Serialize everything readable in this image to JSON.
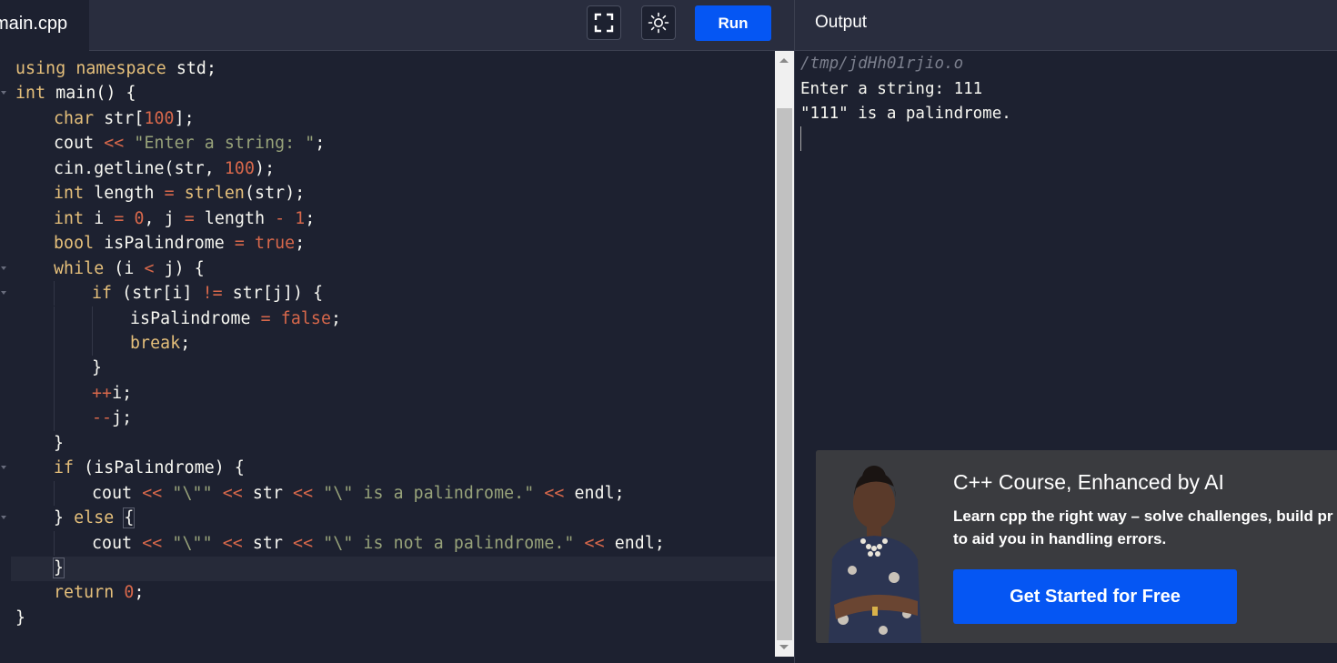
{
  "editor": {
    "file_tab": "main.cpp",
    "run_label": "Run",
    "lines": [
      {
        "indent": 0,
        "fold": false,
        "tokens": [
          {
            "t": "using",
            "c": "kw"
          },
          {
            "t": " "
          },
          {
            "t": "namespace",
            "c": "kw"
          },
          {
            "t": " std;"
          }
        ]
      },
      {
        "indent": 0,
        "fold": true,
        "tokens": [
          {
            "t": "int",
            "c": "kw"
          },
          {
            "t": " main() {"
          }
        ]
      },
      {
        "indent": 1,
        "fold": false,
        "tokens": [
          {
            "t": "char",
            "c": "kw"
          },
          {
            "t": " str["
          },
          {
            "t": "100",
            "c": "num"
          },
          {
            "t": "];"
          }
        ]
      },
      {
        "indent": 1,
        "fold": false,
        "tokens": [
          {
            "t": "cout "
          },
          {
            "t": "<<",
            "c": "op"
          },
          {
            "t": " "
          },
          {
            "t": "\"Enter a string: \"",
            "c": "str"
          },
          {
            "t": ";"
          }
        ]
      },
      {
        "indent": 1,
        "fold": false,
        "tokens": [
          {
            "t": "cin.getline(str, "
          },
          {
            "t": "100",
            "c": "num"
          },
          {
            "t": ");"
          }
        ]
      },
      {
        "indent": 1,
        "fold": false,
        "tokens": [
          {
            "t": "int",
            "c": "kw"
          },
          {
            "t": " length "
          },
          {
            "t": "=",
            "c": "op"
          },
          {
            "t": " "
          },
          {
            "t": "strlen",
            "c": "kw"
          },
          {
            "t": "(str);"
          }
        ]
      },
      {
        "indent": 1,
        "fold": false,
        "tokens": [
          {
            "t": "int",
            "c": "kw"
          },
          {
            "t": " i "
          },
          {
            "t": "=",
            "c": "op"
          },
          {
            "t": " "
          },
          {
            "t": "0",
            "c": "num"
          },
          {
            "t": ", j "
          },
          {
            "t": "=",
            "c": "op"
          },
          {
            "t": " length "
          },
          {
            "t": "-",
            "c": "op"
          },
          {
            "t": " "
          },
          {
            "t": "1",
            "c": "num"
          },
          {
            "t": ";"
          }
        ]
      },
      {
        "indent": 1,
        "fold": false,
        "tokens": [
          {
            "t": "bool",
            "c": "kw"
          },
          {
            "t": " isPalindrome "
          },
          {
            "t": "=",
            "c": "op"
          },
          {
            "t": " "
          },
          {
            "t": "true",
            "c": "num"
          },
          {
            "t": ";"
          }
        ]
      },
      {
        "indent": 1,
        "fold": true,
        "tokens": [
          {
            "t": "while",
            "c": "kw"
          },
          {
            "t": " (i "
          },
          {
            "t": "<",
            "c": "op"
          },
          {
            "t": " j) {"
          }
        ]
      },
      {
        "indent": 2,
        "fold": true,
        "tokens": [
          {
            "t": "if",
            "c": "kw"
          },
          {
            "t": " (str[i] "
          },
          {
            "t": "!=",
            "c": "op"
          },
          {
            "t": " str[j]) {"
          }
        ]
      },
      {
        "indent": 3,
        "fold": false,
        "tokens": [
          {
            "t": "isPalindrome "
          },
          {
            "t": "=",
            "c": "op"
          },
          {
            "t": " "
          },
          {
            "t": "false",
            "c": "num"
          },
          {
            "t": ";"
          }
        ]
      },
      {
        "indent": 3,
        "fold": false,
        "tokens": [
          {
            "t": "break",
            "c": "kw"
          },
          {
            "t": ";"
          }
        ]
      },
      {
        "indent": 2,
        "fold": false,
        "tokens": [
          {
            "t": "}"
          }
        ]
      },
      {
        "indent": 2,
        "fold": false,
        "tokens": [
          {
            "t": "++",
            "c": "op"
          },
          {
            "t": "i;"
          }
        ]
      },
      {
        "indent": 2,
        "fold": false,
        "tokens": [
          {
            "t": "--",
            "c": "op"
          },
          {
            "t": "j;"
          }
        ]
      },
      {
        "indent": 1,
        "fold": false,
        "tokens": [
          {
            "t": "}"
          }
        ]
      },
      {
        "indent": 1,
        "fold": true,
        "tokens": [
          {
            "t": "if",
            "c": "kw"
          },
          {
            "t": " (isPalindrome) {"
          }
        ]
      },
      {
        "indent": 2,
        "fold": false,
        "tokens": [
          {
            "t": "cout "
          },
          {
            "t": "<<",
            "c": "op"
          },
          {
            "t": " "
          },
          {
            "t": "\"\\\"\"",
            "c": "str"
          },
          {
            "t": " "
          },
          {
            "t": "<<",
            "c": "op"
          },
          {
            "t": " str "
          },
          {
            "t": "<<",
            "c": "op"
          },
          {
            "t": " "
          },
          {
            "t": "\"\\\" is a palindrome.\"",
            "c": "str"
          },
          {
            "t": " "
          },
          {
            "t": "<<",
            "c": "op"
          },
          {
            "t": " endl;"
          }
        ]
      },
      {
        "indent": 1,
        "fold": true,
        "tokens": [
          {
            "t": "} "
          },
          {
            "t": "else",
            "c": "kw"
          },
          {
            "t": " "
          },
          {
            "t": "{",
            "c": "brkt"
          }
        ]
      },
      {
        "indent": 2,
        "fold": false,
        "tokens": [
          {
            "t": "cout "
          },
          {
            "t": "<<",
            "c": "op"
          },
          {
            "t": " "
          },
          {
            "t": "\"\\\"\"",
            "c": "str"
          },
          {
            "t": " "
          },
          {
            "t": "<<",
            "c": "op"
          },
          {
            "t": " str "
          },
          {
            "t": "<<",
            "c": "op"
          },
          {
            "t": " "
          },
          {
            "t": "\"\\\" is not a palindrome.\"",
            "c": "str"
          },
          {
            "t": " "
          },
          {
            "t": "<<",
            "c": "op"
          },
          {
            "t": " endl;"
          }
        ]
      },
      {
        "indent": 1,
        "fold": false,
        "tokens": [
          {
            "t": "}",
            "c": "brkt"
          }
        ]
      },
      {
        "indent": 1,
        "fold": false,
        "tokens": [
          {
            "t": "return",
            "c": "kw"
          },
          {
            "t": " "
          },
          {
            "t": "0",
            "c": "num"
          },
          {
            "t": ";"
          }
        ]
      },
      {
        "indent": 0,
        "fold": false,
        "tokens": [
          {
            "t": "}"
          }
        ]
      }
    ]
  },
  "output": {
    "title": "Output",
    "lines": [
      {
        "text": "/tmp/jdHh01rjio.o",
        "style": "path"
      },
      {
        "text": "Enter a string: 111",
        "style": "normal"
      },
      {
        "text": "\"111\" is a palindrome.",
        "style": "normal"
      }
    ]
  },
  "ad": {
    "title": "C++ Course, Enhanced by AI",
    "description": "Learn cpp the right way – solve challenges, build pr AI to aid you in handling errors.",
    "cta": "Get Started for Free"
  },
  "colors": {
    "accent": "#0556f3",
    "keyword": "#e6c07b",
    "string": "#98a37a",
    "number": "#d8684b"
  },
  "icons": [
    "fullscreen-icon",
    "theme-toggle-icon"
  ]
}
